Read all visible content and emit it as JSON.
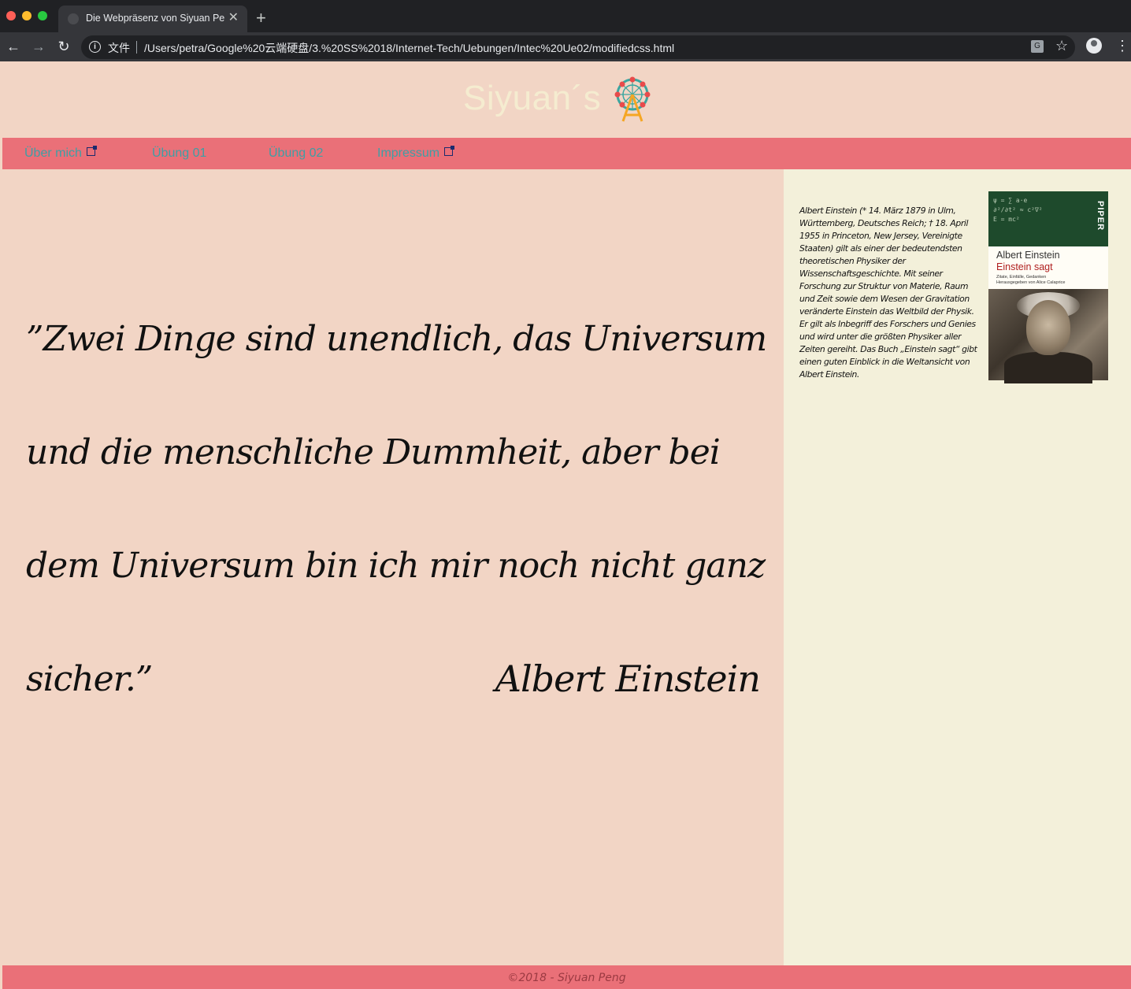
{
  "browser": {
    "tab_title": "Die Webpräsenz von Siyuan Pe",
    "tab_close": "✕",
    "new_tab": "+",
    "back": "←",
    "forward": "→",
    "reload": "↻",
    "info_glyph": "i",
    "file_label": "文件",
    "url": "/Users/petra/Google%20云端硬盘/3.%20SS%2018/Internet-Tech/Uebungen/Intec%20Ue02/modifiedcss.html",
    "star": "☆",
    "menu": "⋮"
  },
  "header": {
    "title": "Siyuan´s"
  },
  "nav": {
    "items": [
      {
        "label": "Über mich",
        "external": true
      },
      {
        "label": "Übung 01",
        "external": false
      },
      {
        "label": "Übung 02",
        "external": false
      },
      {
        "label": "Impressum",
        "external": true
      }
    ]
  },
  "main": {
    "quote": "”Zwei Dinge sind unendlich, das Universum und die menschliche Dummheit, aber bei dem Universum bin ich mir noch nicht ganz sicher.”",
    "author": "Albert Einstein"
  },
  "aside": {
    "bio": "Albert Einstein (* 14. März 1879 in Ulm, Württemberg, Deutsches Reich; † 18. April 1955 in Princeton, New Jersey, Vereinigte Staaten) gilt als einer der bedeutendsten theoretischen Physiker der Wissenschaftsgeschichte. Mit seiner Forschung zur Struktur von Materie, Raum und Zeit sowie dem Wesen der Gravitation veränderte Einstein das Weltbild der Physik. Er gilt als Inbegriff des Forschers und Genies und wird unter die größten Physiker aller Zeiten gereiht. Das Buch „Einstein sagt“ gibt einen guten Einblick in die Weltansicht von Albert Einstein.",
    "book": {
      "publisher": "PIPER",
      "author": "Albert Einstein",
      "title": "Einstein sagt",
      "subtitle": "Zitate, Einfälle, Gedanken",
      "editor": "Herausgegeben von Alice Calaprice"
    }
  },
  "footer": {
    "text": "©2018 - Siyuan Peng"
  },
  "colors": {
    "page_bg": "#f2d5c5",
    "nav_bg": "#ea7078",
    "nav_text": "#3e9fa5",
    "aside_bg": "#f3f0da",
    "title_color": "#f5ecd0"
  }
}
